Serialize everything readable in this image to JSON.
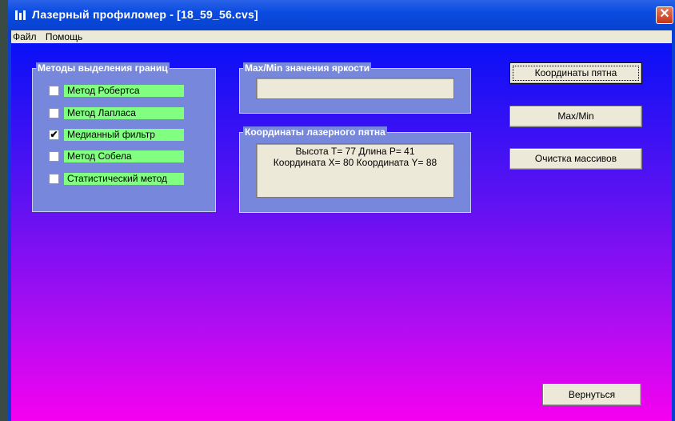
{
  "window": {
    "title": "Лазерный профиломер - [18_59_56.cvs]",
    "close_symbol": "✕"
  },
  "menu": {
    "items": [
      "Файл",
      "Помощь"
    ]
  },
  "methods_group": {
    "title": "Методы выделения границ",
    "items": [
      {
        "label": "Метод Робертса",
        "checked": false
      },
      {
        "label": "Метод Лапласа",
        "checked": false
      },
      {
        "label": "Медианный фильтр",
        "checked": true
      },
      {
        "label": "Метод Собела",
        "checked": false
      },
      {
        "label": "Статистический метод",
        "checked": false
      }
    ]
  },
  "maxmin_group": {
    "title": "Max/Min значения яркости",
    "value": ""
  },
  "coords_group": {
    "title": "Координаты лазерного пятна",
    "line1": "Высота T= 77  Длина  P= 41",
    "line2": "Координата X= 80  Координата Y= 88"
  },
  "buttons": {
    "coords": "Координаты пятна",
    "maxmin": "Max/Min",
    "clear": "Очистка массивов",
    "back": "Вернуться"
  },
  "icons": {
    "app": "bar-chart-icon",
    "close": "close-icon"
  }
}
